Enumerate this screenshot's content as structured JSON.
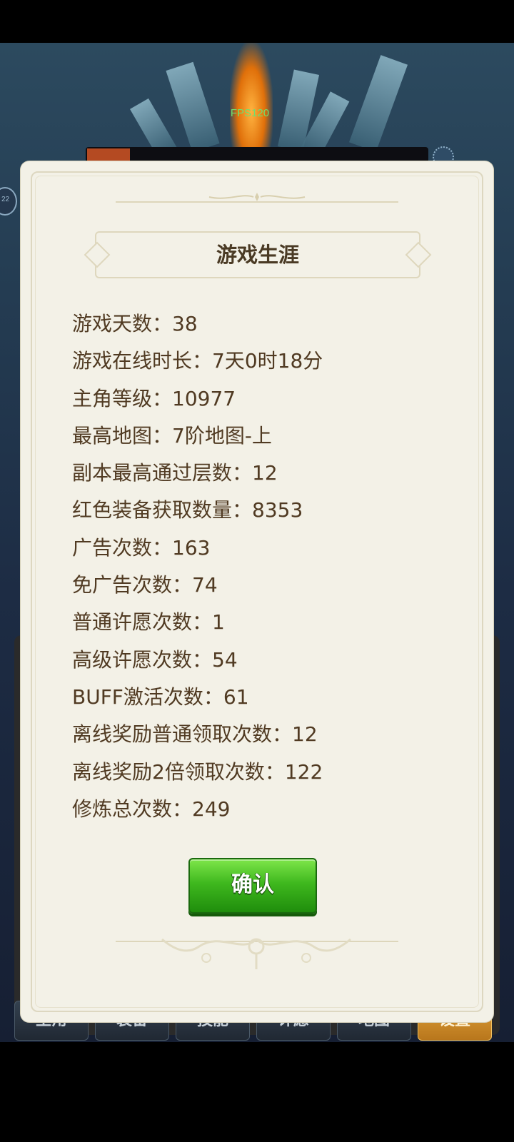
{
  "hud": {
    "fps": "FPS120",
    "side_badge": "22"
  },
  "dialog": {
    "title": "游戏生涯",
    "stats": [
      "游戏天数：38",
      "游戏在线时长：7天0时18分",
      "主角等级：10977",
      "最高地图：7阶地图-上",
      "副本最高通过层数：12",
      "红色装备获取数量：8353",
      "广告次数：163",
      "免广告次数：74",
      "普通许愿次数：1",
      "高级许愿次数：54",
      "BUFF激活次数：61",
      "离线奖励普通领取次数：12",
      "离线奖励2倍领取次数：122",
      "修炼总次数：249"
    ],
    "confirm_label": "确认"
  },
  "nav": {
    "tabs": [
      "主角",
      "装备",
      "技能",
      "许愿",
      "地图",
      "设置"
    ],
    "active_tab": "设置"
  },
  "colors": {
    "dialog_bg": "#f3f1e7",
    "text": "#503a22",
    "confirm_button": "#3fb81e"
  }
}
